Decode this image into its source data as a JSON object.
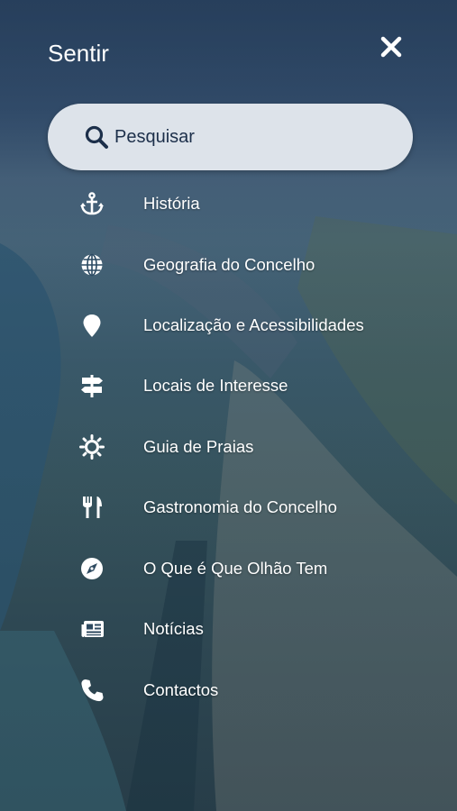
{
  "header": {
    "title": "Sentir"
  },
  "search": {
    "placeholder": "Pesquisar"
  },
  "menu": {
    "items": [
      {
        "label": "História",
        "icon": "anchor-icon"
      },
      {
        "label": "Geografia do Concelho",
        "icon": "globe-icon"
      },
      {
        "label": "Localização e Acessibilidades",
        "icon": "map-pin-icon"
      },
      {
        "label": "Locais de Interesse",
        "icon": "signpost-icon"
      },
      {
        "label": "Guia de Praias",
        "icon": "sun-icon"
      },
      {
        "label": "Gastronomia do Concelho",
        "icon": "utensils-icon"
      },
      {
        "label": "O Que é Que Olhão Tem",
        "icon": "compass-icon"
      },
      {
        "label": "Notícias",
        "icon": "newspaper-icon"
      },
      {
        "label": "Contactos",
        "icon": "phone-icon"
      }
    ]
  },
  "colors": {
    "accent": "#1c2f4a",
    "search_bg": "#dde3ea"
  }
}
